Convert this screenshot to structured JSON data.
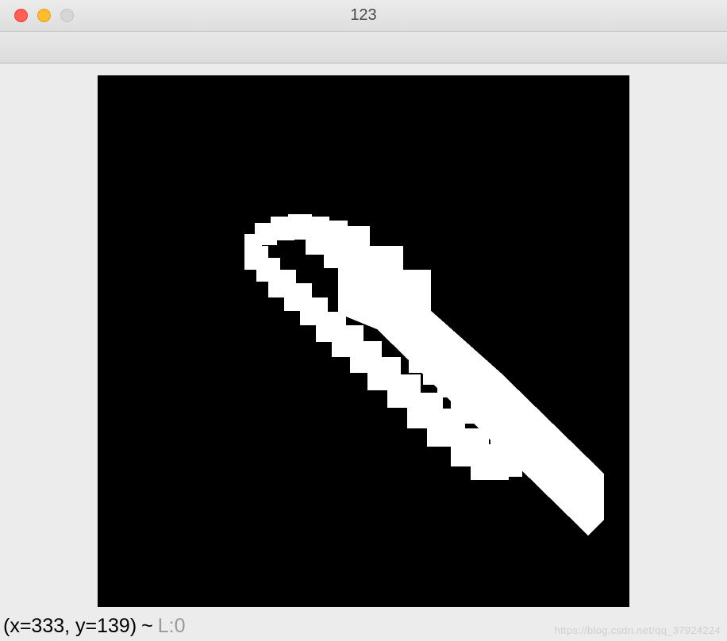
{
  "window": {
    "title": "123"
  },
  "status": {
    "coords": "(x=333, y=139)",
    "separator": "~",
    "luminance": "L:0"
  },
  "watermark": "https://blog.csdn.net/qq_37924224",
  "image": {
    "background_color": "#000000",
    "shape_color": "#FFFFFF",
    "shape_polygon_points": "303,270 390,270 508,375 638,502 638,560 618,580 470,435 352,320 303,300"
  }
}
